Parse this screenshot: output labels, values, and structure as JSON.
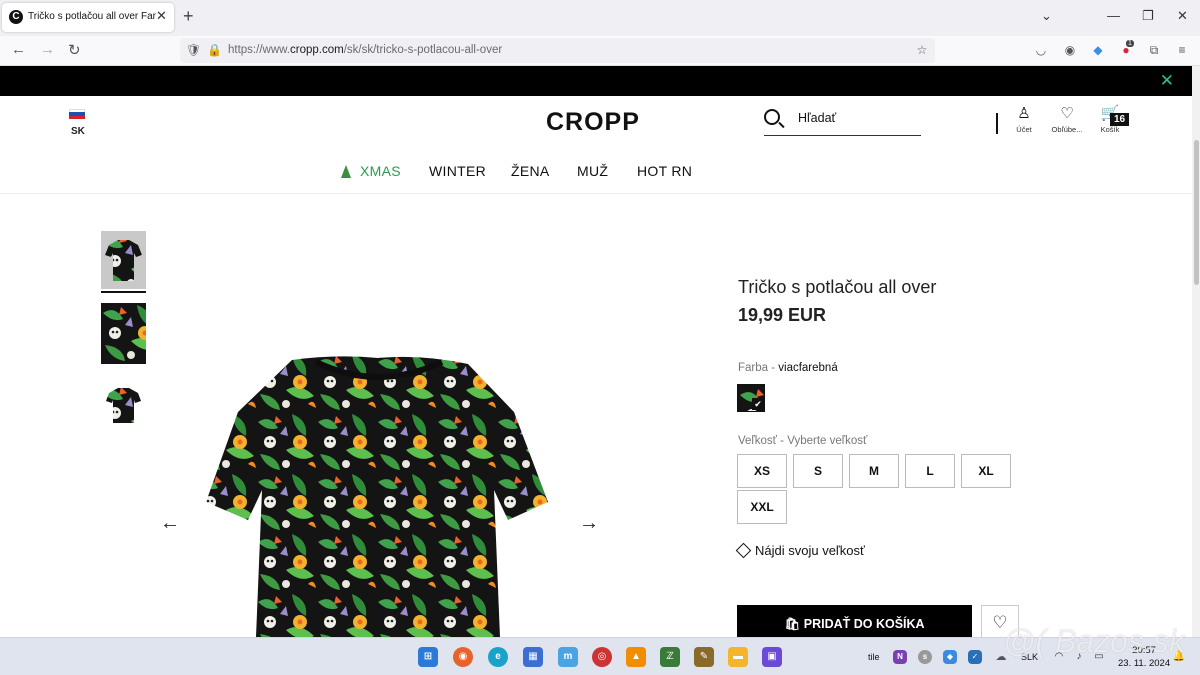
{
  "browser": {
    "tab_title": "Tričko s potlačou all over Farba",
    "tab_favicon": "C",
    "url_prefix": "https://www.",
    "url_domain": "cropp.com",
    "url_path": "/sk/sk/tricko-s-potlacou-all-over",
    "notification_count": "1"
  },
  "header": {
    "country": "SK",
    "logo": "CROPP",
    "search_placeholder": "Hľadať",
    "account_label": "Účet",
    "favorites_label": "Obľúbe...",
    "cart_label": "Košík",
    "cart_count": "16"
  },
  "menu": {
    "items": [
      "XMAS",
      "WINTER",
      "ŽENA",
      "MUŽ",
      "HOT RN"
    ]
  },
  "product": {
    "title": "Tričko s potlačou all over",
    "price": "19,99 EUR",
    "color_label": "Farba - ",
    "color_value": "viacfarebná",
    "size_label": "Veľkosť - Vyberte veľkosť",
    "sizes": [
      "XS",
      "S",
      "M",
      "L",
      "XL",
      "XXL"
    ],
    "size_guide": "Nájdi svoju veľkosť",
    "add_to_cart": "PRIDAŤ DO KOŠÍKA"
  },
  "taskbar": {
    "tile_label": "tile",
    "language": "SLK",
    "time": "20:57",
    "date": "23. 11. 2024"
  },
  "watermark": "@( Bazos.sk",
  "colors": {
    "accent_green": "#2e9b4e",
    "close_green": "#2ec27e",
    "black": "#000000"
  }
}
